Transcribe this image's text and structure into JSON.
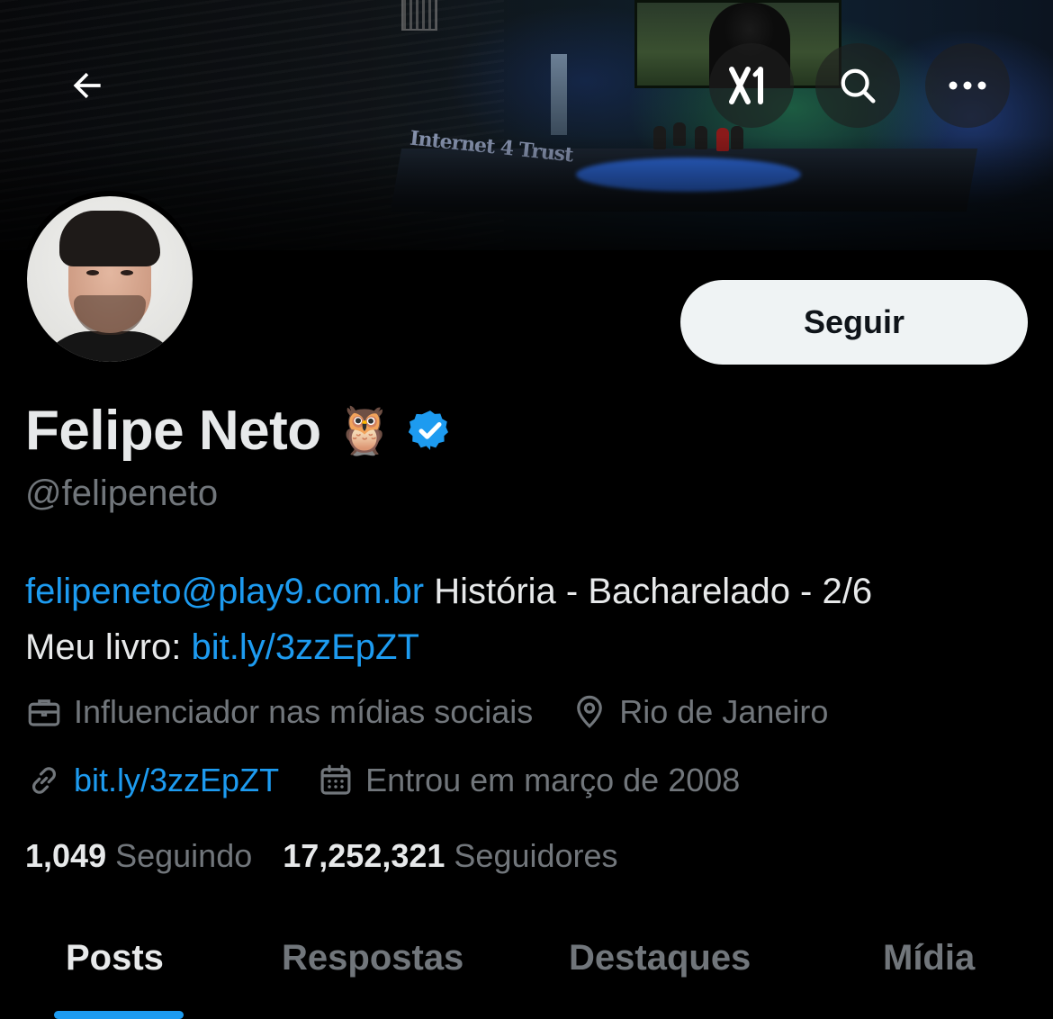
{
  "header": {
    "back_icon": "arrow-left-icon",
    "grok_icon": "grok-icon",
    "search_icon": "search-icon",
    "more_icon": "more-horizontal-icon"
  },
  "banner": {
    "sign_text": "Internet 4 Trust"
  },
  "profile": {
    "display_name": "Felipe Neto",
    "emoji": "🦉",
    "verified": true,
    "handle": "@felipeneto",
    "follow_label": "Seguir",
    "bio": {
      "email": "felipeneto@play9.com.br",
      "line1_rest": " História - Bacharelado - 2/6",
      "line2_prefix": "Meu livro: ",
      "line2_link": "bit.ly/3zzEpZT"
    },
    "category": "Influenciador nas mídias sociais",
    "location": "Rio de Janeiro",
    "website": "bit.ly/3zzEpZT",
    "joined": "Entrou em março de 2008",
    "following_count": "1,049",
    "following_label": "Seguindo",
    "followers_count": "17,252,321",
    "followers_label": "Seguidores"
  },
  "tabs": [
    {
      "label": "Posts",
      "active": true
    },
    {
      "label": "Respostas",
      "active": false
    },
    {
      "label": "Destaques",
      "active": false
    },
    {
      "label": "Mídia",
      "active": false
    }
  ],
  "colors": {
    "accent": "#1d9bf0",
    "background": "#000000",
    "text_primary": "#e7e9ea",
    "text_secondary": "#71767b"
  }
}
